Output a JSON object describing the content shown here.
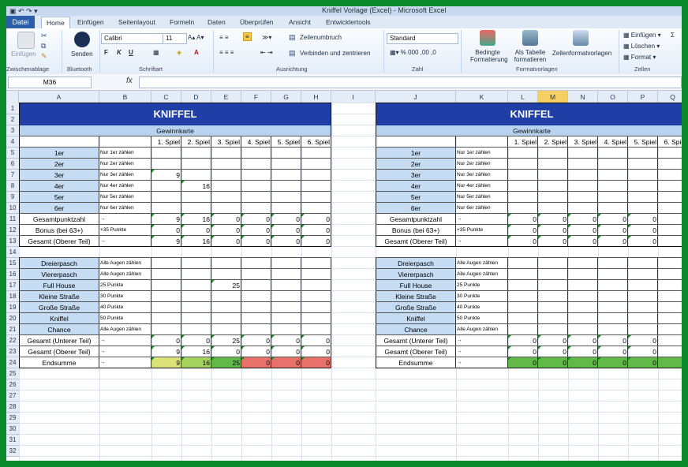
{
  "window": {
    "title": "Kniffel Vorlage (Excel) - Microsoft Excel"
  },
  "tabs": {
    "file": "Datei",
    "items": [
      "Home",
      "Einfügen",
      "Seitenlayout",
      "Formeln",
      "Daten",
      "Überprüfen",
      "Ansicht",
      "Entwicklertools"
    ],
    "active": "Home"
  },
  "ribbon": {
    "paste": "Einfügen",
    "send": "Senden",
    "font_name": "Calibri",
    "font_size": "11",
    "wrap": "Zeilenumbruch",
    "merge": "Verbinden und zentrieren",
    "number_format": "Standard",
    "cond_format": "Bedingte Formatierung",
    "as_table": "Als Tabelle formatieren",
    "cell_styles": "Zellenformatvorlagen",
    "insert": "Einfügen",
    "delete": "Löschen",
    "format": "Format",
    "groups": [
      "Zwischenablage",
      "Bluetooth",
      "Schriftart",
      "Ausrichtung",
      "Zahl",
      "Formatvorlagen",
      "Zellen"
    ]
  },
  "formula_bar": {
    "name_box": "M36",
    "fx": "fx",
    "value": ""
  },
  "columns": [
    "A",
    "B",
    "C",
    "D",
    "E",
    "F",
    "G",
    "H",
    "I",
    "J",
    "K",
    "L",
    "M",
    "N",
    "O",
    "P",
    "Q"
  ],
  "selected_column": "M",
  "rows": [
    "1",
    "2",
    "3",
    "4",
    "5",
    "6",
    "7",
    "8",
    "9",
    "10",
    "11",
    "12",
    "13",
    "14",
    "15",
    "16",
    "17",
    "18",
    "19",
    "20",
    "21",
    "22",
    "23",
    "24",
    "25",
    "26",
    "27",
    "28",
    "29",
    "30",
    "31",
    "32"
  ],
  "sheet": {
    "title": "KNIFFEL",
    "subtitle": "Gewinnkarte",
    "games": [
      "1. Spiel",
      "2. Spiel",
      "3. Spiel",
      "4. Spiel",
      "5. Spiel",
      "6. Spiel"
    ],
    "upper": [
      {
        "label": "1er",
        "hint": "Nur 1er zählen"
      },
      {
        "label": "2er",
        "hint": "Nur 2er zählen"
      },
      {
        "label": "3er",
        "hint": "Nur 3er zählen"
      },
      {
        "label": "4er",
        "hint": "Nur 4er zählen"
      },
      {
        "label": "5er",
        "hint": "Nur 5er zählen"
      },
      {
        "label": "6er",
        "hint": "Nur 6er zählen"
      }
    ],
    "upper_totals": [
      {
        "label": "Gesamtpunktzahl",
        "hint": "→"
      },
      {
        "label": "Bonus (bei 63+)",
        "hint": "+35 Punkte"
      },
      {
        "label": "Gesamt (Oberer Teil)",
        "hint": "→"
      }
    ],
    "lower": [
      {
        "label": "Dreierpasch",
        "hint": "Alle Augen zählen"
      },
      {
        "label": "Viererpasch",
        "hint": "Alle Augen zählen"
      },
      {
        "label": "Full House",
        "hint": "25 Punkte"
      },
      {
        "label": "Kleine Straße",
        "hint": "30 Punkte"
      },
      {
        "label": "Große Straße",
        "hint": "40 Punkte"
      },
      {
        "label": "Kniffel",
        "hint": "50 Punkte"
      },
      {
        "label": "Chance",
        "hint": "Alle Augen zählen"
      }
    ],
    "lower_totals": [
      {
        "label": "Gesamt (Unterer Teil)",
        "hint": "→"
      },
      {
        "label": "Gesamt (Oberer Teil)",
        "hint": "→"
      },
      {
        "label": "Endsumme",
        "hint": "→"
      }
    ],
    "left_values": {
      "upper": [
        [
          "",
          "",
          "",
          "",
          "",
          ""
        ],
        [
          "",
          "",
          "",
          "",
          "",
          ""
        ],
        [
          "9",
          "",
          "",
          "",
          "",
          ""
        ],
        [
          "",
          "16",
          "",
          "",
          "",
          ""
        ],
        [
          "",
          "",
          "",
          "",
          "",
          ""
        ],
        [
          "",
          "",
          "",
          "",
          "",
          ""
        ]
      ],
      "upper_totals": [
        [
          "9",
          "16",
          "0",
          "0",
          "0",
          "0"
        ],
        [
          "0",
          "0",
          "0",
          "0",
          "0",
          "0"
        ],
        [
          "9",
          "16",
          "0",
          "0",
          "0",
          "0"
        ]
      ],
      "lower": [
        [
          "",
          "",
          "",
          "",
          "",
          ""
        ],
        [
          "",
          "",
          "",
          "",
          "",
          ""
        ],
        [
          "",
          "",
          "25",
          "",
          "",
          ""
        ],
        [
          "",
          "",
          "",
          "",
          "",
          ""
        ],
        [
          "",
          "",
          "",
          "",
          "",
          ""
        ],
        [
          "",
          "",
          "",
          "",
          "",
          ""
        ],
        [
          "",
          "",
          "",
          "",
          "",
          ""
        ]
      ],
      "lower_totals": [
        [
          "0",
          "0",
          "25",
          "0",
          "0",
          "0"
        ],
        [
          "9",
          "16",
          "0",
          "0",
          "0",
          "0"
        ],
        [
          "9",
          "16",
          "25",
          "0",
          "0",
          "0"
        ]
      ]
    },
    "right_values": {
      "upper": [
        [
          "",
          "",
          "",
          "",
          "",
          ""
        ],
        [
          "",
          "",
          "",
          "",
          "",
          ""
        ],
        [
          "",
          "",
          "",
          "",
          "",
          ""
        ],
        [
          "",
          "",
          "",
          "",
          "",
          ""
        ],
        [
          "",
          "",
          "",
          "",
          "",
          ""
        ],
        [
          "",
          "",
          "",
          "",
          "",
          ""
        ]
      ],
      "upper_totals": [
        [
          "0",
          "0",
          "0",
          "0",
          "0",
          ""
        ],
        [
          "0",
          "0",
          "0",
          "0",
          "0",
          ""
        ],
        [
          "0",
          "0",
          "0",
          "0",
          "0",
          ""
        ]
      ],
      "lower": [
        [
          "",
          "",
          "",
          "",
          "",
          ""
        ],
        [
          "",
          "",
          "",
          "",
          "",
          ""
        ],
        [
          "",
          "",
          "",
          "",
          "",
          ""
        ],
        [
          "",
          "",
          "",
          "",
          "",
          ""
        ],
        [
          "",
          "",
          "",
          "",
          "",
          ""
        ],
        [
          "",
          "",
          "",
          "",
          "",
          ""
        ],
        [
          "",
          "",
          "",
          "",
          "",
          ""
        ]
      ],
      "lower_totals": [
        [
          "0",
          "0",
          "0",
          "0",
          "0",
          ""
        ],
        [
          "0",
          "0",
          "0",
          "0",
          "0",
          ""
        ],
        [
          "0",
          "0",
          "0",
          "0",
          "0",
          ""
        ]
      ]
    },
    "endsumme_colors_left": [
      "#dbe27a",
      "#a6d25f",
      "#63b84a",
      "#e8716b",
      "#e8716b",
      "#e8716b"
    ],
    "endsumme_colors_right": [
      "#63b84a",
      "#63b84a",
      "#63b84a",
      "#63b84a",
      "#63b84a",
      "#63b84a"
    ]
  },
  "colors": {
    "title_bg": "#1f3fa6",
    "label_bg": "#c6dcf3",
    "subtitle_bg": "#b8d3f0",
    "frame": "#0a8a2a"
  }
}
